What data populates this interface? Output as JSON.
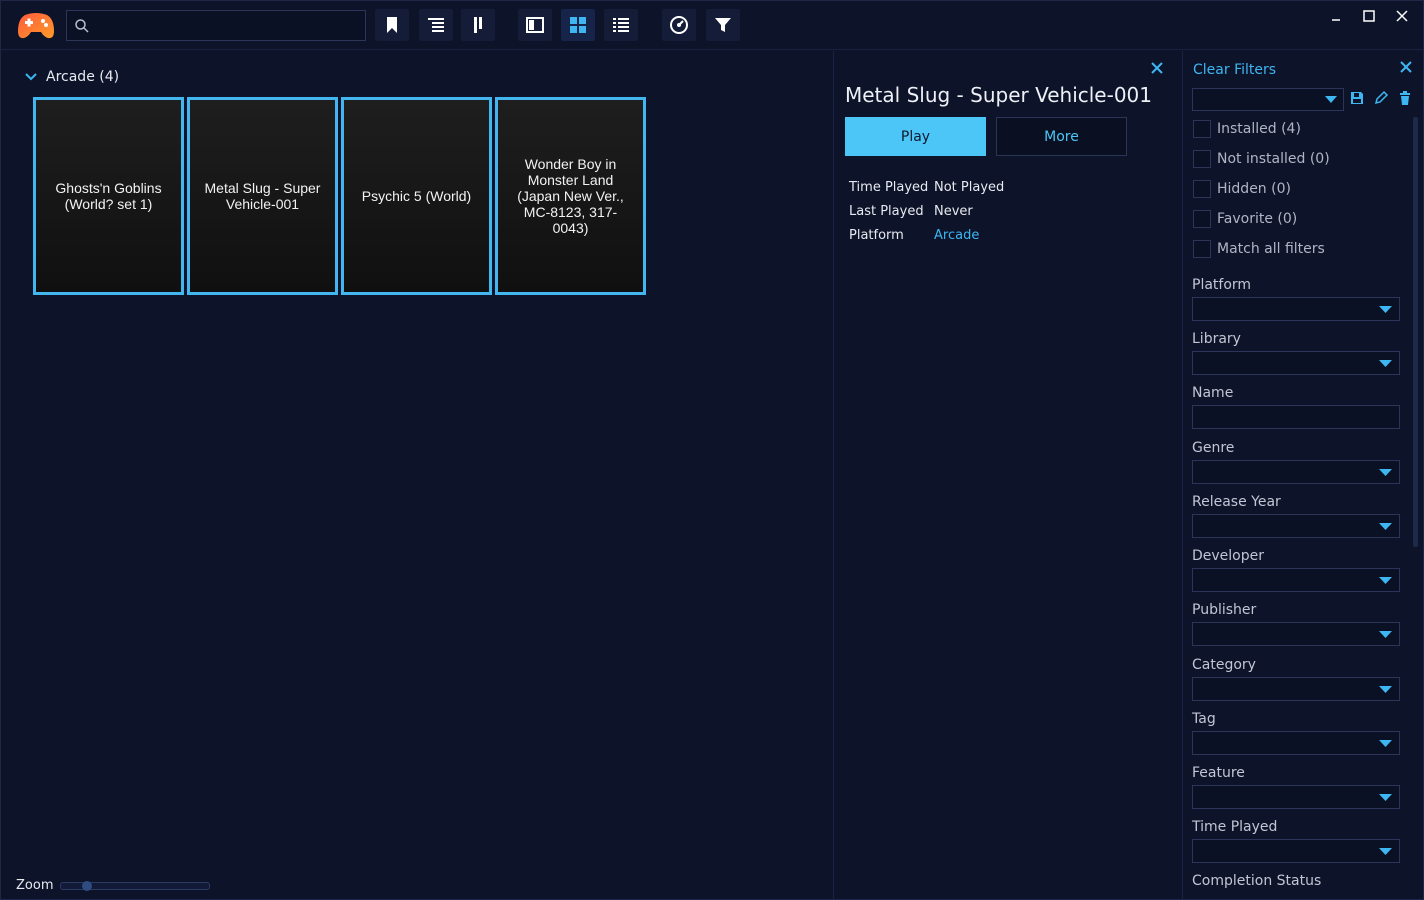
{
  "toolbar": {
    "search_placeholder": "",
    "buttons": [
      "bookmark-icon",
      "grouping-icon",
      "sort-icon",
      "details-view-icon",
      "grid-view-icon",
      "list-view-icon",
      "explore-icon",
      "filter-icon"
    ]
  },
  "colors": {
    "accent": "#43b6f0",
    "background": "#0d1329",
    "play_button": "#4cc6f6",
    "link": "#3db6f2"
  },
  "library": {
    "group_name": "Arcade (4)",
    "games": [
      "Ghosts'n Goblins (World? set 1)",
      "Metal Slug - Super Vehicle-001",
      "Psychic 5 (World)",
      "Wonder Boy in Monster Land (Japan New Ver., MC-8123, 317-0043)"
    ]
  },
  "zoom": {
    "label": "Zoom",
    "level_fraction": 0.15
  },
  "details": {
    "title": "Metal Slug - Super Vehicle-001",
    "play_label": "Play",
    "more_label": "More",
    "rows": [
      {
        "label": "Time Played",
        "value": "Not Played"
      },
      {
        "label": "Last Played",
        "value": "Never"
      },
      {
        "label": "Platform",
        "value": "Arcade"
      }
    ]
  },
  "filters": {
    "clear_label": "Clear Filters",
    "checks": [
      "Installed (4)",
      "Not installed (0)",
      "Hidden (0)",
      "Favorite (0)",
      "Match all filters"
    ],
    "fields": [
      {
        "label": "Platform",
        "type": "dropdown"
      },
      {
        "label": "Library",
        "type": "dropdown"
      },
      {
        "label": "Name",
        "type": "text"
      },
      {
        "label": "Genre",
        "type": "dropdown"
      },
      {
        "label": "Release Year",
        "type": "dropdown"
      },
      {
        "label": "Developer",
        "type": "dropdown"
      },
      {
        "label": "Publisher",
        "type": "dropdown"
      },
      {
        "label": "Category",
        "type": "dropdown"
      },
      {
        "label": "Tag",
        "type": "dropdown"
      },
      {
        "label": "Feature",
        "type": "dropdown"
      },
      {
        "label": "Time Played",
        "type": "dropdown"
      },
      {
        "label": "Completion Status",
        "type": "dropdown"
      }
    ]
  }
}
